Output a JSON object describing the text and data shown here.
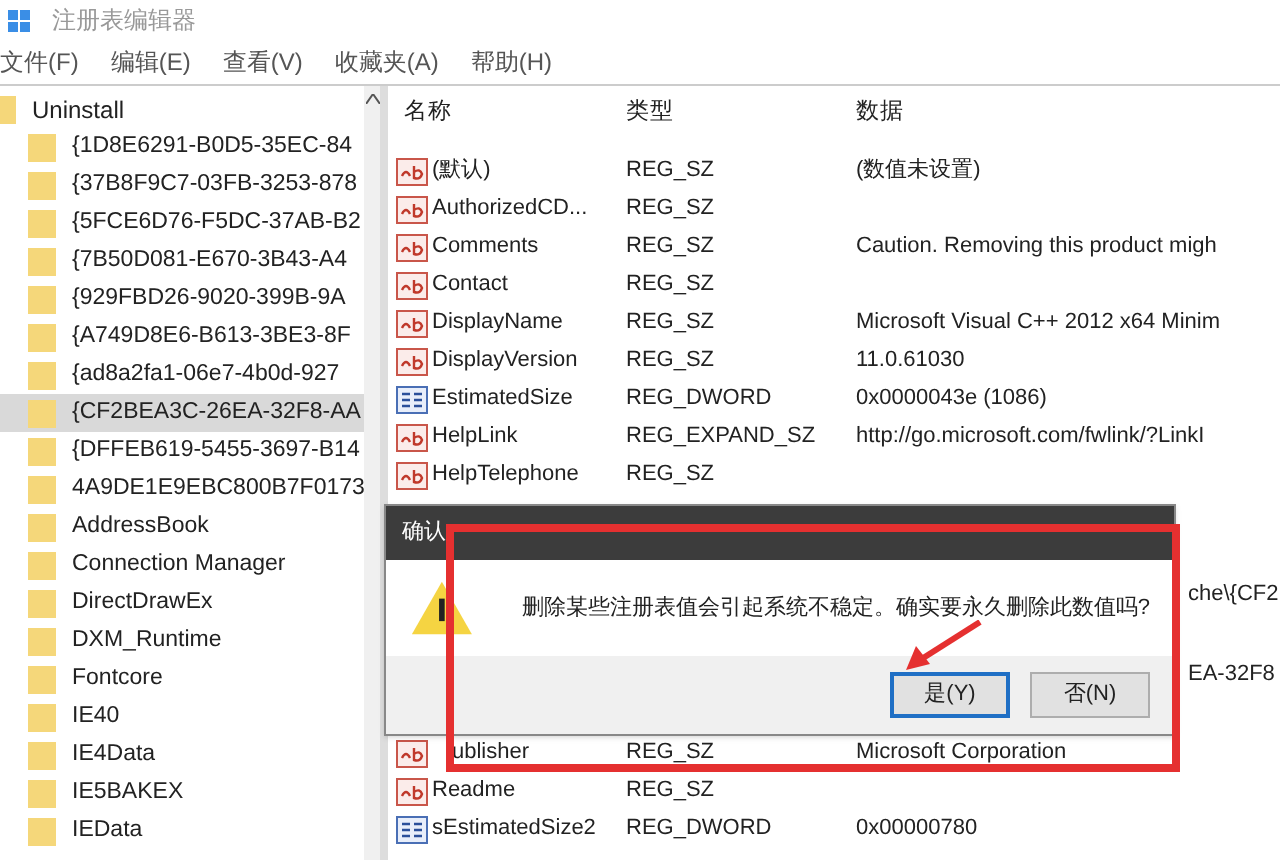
{
  "window": {
    "title": "注册表编辑器"
  },
  "menu": [
    "文件(F)",
    "编辑(E)",
    "查看(V)",
    "收藏夹(A)",
    "帮助(H)"
  ],
  "tree": {
    "label": "Uninstall",
    "expanded": true,
    "children": [
      {
        "label": "{1D8E6291-B0D5-35EC-84",
        "selected": false
      },
      {
        "label": "{37B8F9C7-03FB-3253-878",
        "selected": false
      },
      {
        "label": "{5FCE6D76-F5DC-37AB-B2",
        "selected": false
      },
      {
        "label": "{7B50D081-E670-3B43-A4",
        "selected": false
      },
      {
        "label": "{929FBD26-9020-399B-9A",
        "selected": false
      },
      {
        "label": "{A749D8E6-B613-3BE3-8F",
        "selected": false
      },
      {
        "label": "{ad8a2fa1-06e7-4b0d-927",
        "selected": false
      },
      {
        "label": "{CF2BEA3C-26EA-32F8-AA",
        "selected": true
      },
      {
        "label": "{DFFEB619-5455-3697-B14",
        "selected": false
      },
      {
        "label": "4A9DE1E9EBC800B7F0173",
        "selected": false
      },
      {
        "label": "AddressBook",
        "selected": false
      },
      {
        "label": "Connection Manager",
        "selected": false
      },
      {
        "label": "DirectDrawEx",
        "selected": false
      },
      {
        "label": "DXM_Runtime",
        "selected": false
      },
      {
        "label": "Fontcore",
        "selected": false
      },
      {
        "label": "IE40",
        "selected": false
      },
      {
        "label": "IE4Data",
        "selected": false
      },
      {
        "label": "IE5BAKEX",
        "selected": false
      },
      {
        "label": "IEData",
        "selected": false
      }
    ]
  },
  "table": {
    "columns": [
      "名称",
      "类型",
      "数据"
    ],
    "rows": [
      {
        "kind": "string",
        "name": "(默认)",
        "type": "REG_SZ",
        "data": "(数值未设置)"
      },
      {
        "kind": "string",
        "name": "AuthorizedCD...",
        "type": "REG_SZ"
      },
      {
        "kind": "string",
        "name": "Comments",
        "type": "REG_SZ",
        "data": "Caution. Removing this product migh"
      },
      {
        "kind": "string",
        "name": "Contact",
        "type": "REG_SZ"
      },
      {
        "kind": "string",
        "name": "DisplayName",
        "type": "REG_SZ",
        "data": "Microsoft Visual C++ 2012 x64 Minim"
      },
      {
        "kind": "string",
        "name": "DisplayVersion",
        "type": "REG_SZ",
        "data": "11.0.61030"
      },
      {
        "kind": "binary",
        "name": "EstimatedSize",
        "type": "REG_DWORD",
        "data": "0x0000043e (1086)"
      },
      {
        "kind": "string",
        "name": "HelpLink",
        "type": "REG_EXPAND_SZ",
        "data": "http://go.microsoft.com/fwlink/?LinkI"
      },
      {
        "kind": "string",
        "name": "HelpTelephone",
        "type": "REG_SZ"
      },
      {
        "kind": "hidden"
      },
      {
        "kind": "hidden"
      },
      {
        "kind": "hidden",
        "data": "che\\{CF2"
      },
      {
        "kind": "hidden"
      },
      {
        "kind": "hidden",
        "data": "EA-32F8"
      },
      {
        "kind": "hidden"
      },
      {
        "kind": "covered",
        "name": "ublisher",
        "type": "REG_SZ",
        "data": "Microsoft Corporation"
      },
      {
        "kind": "string",
        "name": "Readme",
        "type": "REG_SZ"
      },
      {
        "kind": "binary",
        "name": "sEstimatedSize2",
        "type": "REG_DWORD",
        "data": "0x00000780"
      }
    ]
  },
  "dialog": {
    "title": "确认",
    "message": "删除某些注册表值会引起系统不稳定。确实要永久删除此数值吗?",
    "buttons": [
      {
        "label": "是(Y)",
        "selected": true
      },
      {
        "label": "否(N)",
        "selected": false
      }
    ]
  }
}
